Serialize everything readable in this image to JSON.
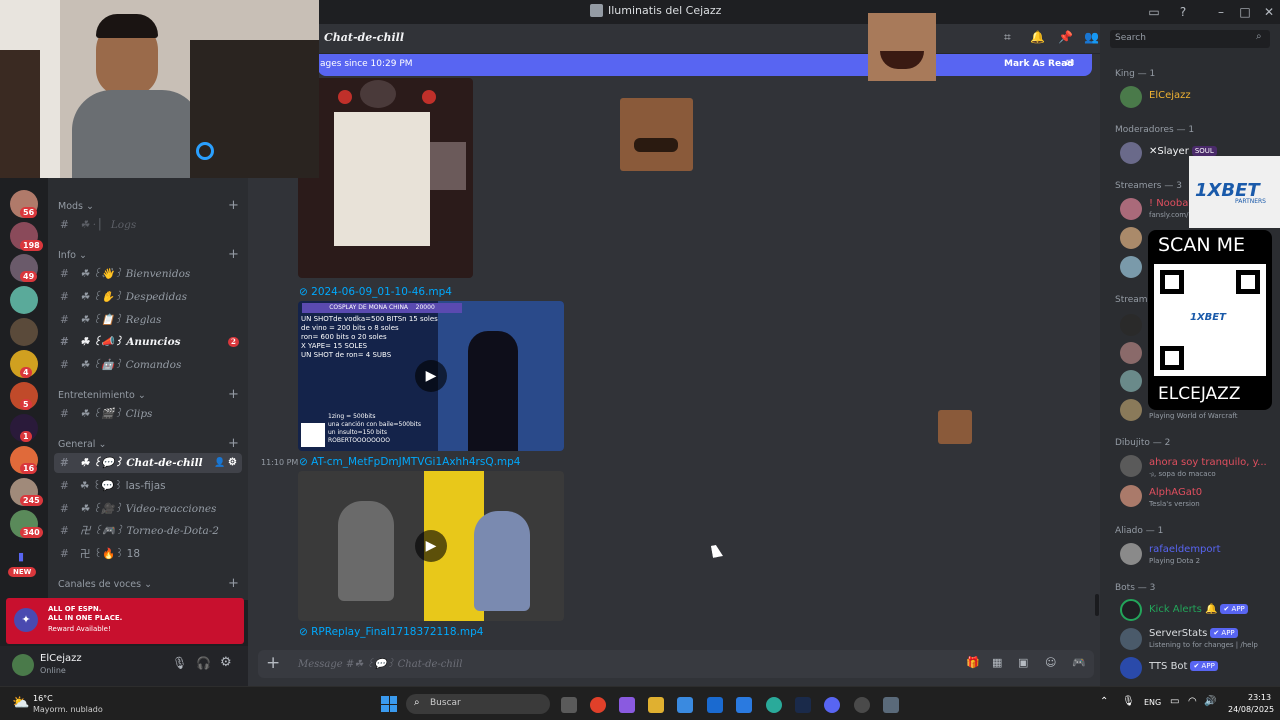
{
  "window": {
    "title": "Iluminatis del Cejazz",
    "inbox_icon": "inbox-icon",
    "help_icon": "help-icon"
  },
  "servers": {
    "badges": [
      "56",
      "198",
      "49",
      "4",
      "5",
      "1",
      "16",
      "245",
      "340"
    ],
    "new_label": "NEW"
  },
  "channels": {
    "categories": {
      "mods": "Mods",
      "info": "Info",
      "entretenimiento": "Entretenimiento",
      "general": "General",
      "voces": "Canales de voces"
    },
    "items": {
      "logs": "☘ · ▏ Logs",
      "bienvenidos": "☘ ꒰👋꒱ Bienvenidos",
      "despedidas": "☘ ꒰✋꒱ Despedidas",
      "reglas": "☘ ꒰📋꒱ Reglas",
      "anuncios": "☘ ꒰📣꒱ Anuncios",
      "anuncios_badge": "2",
      "comandos": "☘ ꒰🤖꒱ Comandos",
      "clips": "☘ ꒰🎬꒱ Clips",
      "chat": "☘ ꒰💬꒱ Chat-de-chill",
      "fijas": "☘ ꒰💬꒱ las-fijas",
      "video": "☘ ꒰🎥꒱ Video-reacciones",
      "torneo": "卍 ꒰🎮꒱ Torneo-de-Dota-2",
      "n18": "卍 ꒰🔥꒱ 18"
    }
  },
  "promo": {
    "line1": "ALL OF ESPN.",
    "line2": "ALL IN ONE PLACE.",
    "line3": "Reward Available!"
  },
  "user": {
    "name": "ElCejazz",
    "status": "Online"
  },
  "chat": {
    "channel_name": "Chat-de-chill",
    "new_messages": "ages since 10:29 PM",
    "mark_read": "Mark As Read",
    "attachments": [
      "2024-06-09_01-10-46.mp4",
      "AT-cm_MetFpDmJMTVGi1Axhh4rsQ.mp4",
      "RPReplay_Final1718372118.mp4"
    ],
    "timestamp": "11:10 PM",
    "video1_header": "COSPLAY DE MONA CHINA",
    "video1_header_value": "20000",
    "video1_lines": [
      "UN SHOTde vodka=500 BITSn 15 soles",
      "de vino = 200 bits o 8 soles",
      "ron= 600 bits  o 20 soles",
      "X YAPE= 15 SOLES",
      "UN SHOT de ron= 4 SUBS"
    ],
    "video1_lines2": [
      "1zing = 500bits",
      "una canción con baile=500bits",
      "un insulto=150 bits",
      "ROBERTOOOOOOOO"
    ],
    "composer_placeholder": "Message #☘ ꒰💬꒱ Chat-de-chill"
  },
  "members": {
    "search_placeholder": "Search",
    "categories": [
      "King — 1",
      "Moderadores — 1",
      "Streamers — 3",
      "Streame",
      "Dibujito — 2",
      "Aliado — 1",
      "Bots — 3"
    ],
    "list": [
      {
        "name": "ElCejazz",
        "status": "",
        "color": "#f0b232"
      },
      {
        "name": "✕Slayer",
        "status": "",
        "color": "#f2f3f5",
        "tag": "SOUL"
      },
      {
        "name": "! Noobat",
        "status": "fansly.com/",
        "color": "#e04f5f"
      },
      {
        "name": "",
        "status": "Playing World of Warcraft",
        "color": "#dbdee1"
      },
      {
        "name": "ahora soy tranquilo, y...",
        "status": "·ᵦ, sopa do macaco",
        "color": "#e04f5f"
      },
      {
        "name": "AlphAGat0",
        "status": "Tesla's version",
        "color": "#e04f5f"
      },
      {
        "name": "rafaeldemport",
        "status": "Playing Dota 2",
        "color": "#5865f2"
      },
      {
        "name": "Kick Alerts 🔔",
        "status": "",
        "color": "#23a55a",
        "app": "✔ APP"
      },
      {
        "name": "ServerStats",
        "status": "Listening to for changes | /help",
        "color": "#dbdee1",
        "app": "✔ APP"
      },
      {
        "name": "TTS Bot",
        "status": "",
        "color": "#dbdee1",
        "app": "✔ APP"
      }
    ]
  },
  "overlay": {
    "brand": "1XBET",
    "brand_sub": "PARTNERS",
    "scan": "SCAN ME",
    "handle": "ELCEJAZZ",
    "qr_mid": "1XBET"
  },
  "taskbar": {
    "temp": "16°C",
    "weather": "Mayorm. nublado",
    "search": "Buscar",
    "lang": "ENG",
    "time": "23:13",
    "date": "24/08/2025"
  }
}
